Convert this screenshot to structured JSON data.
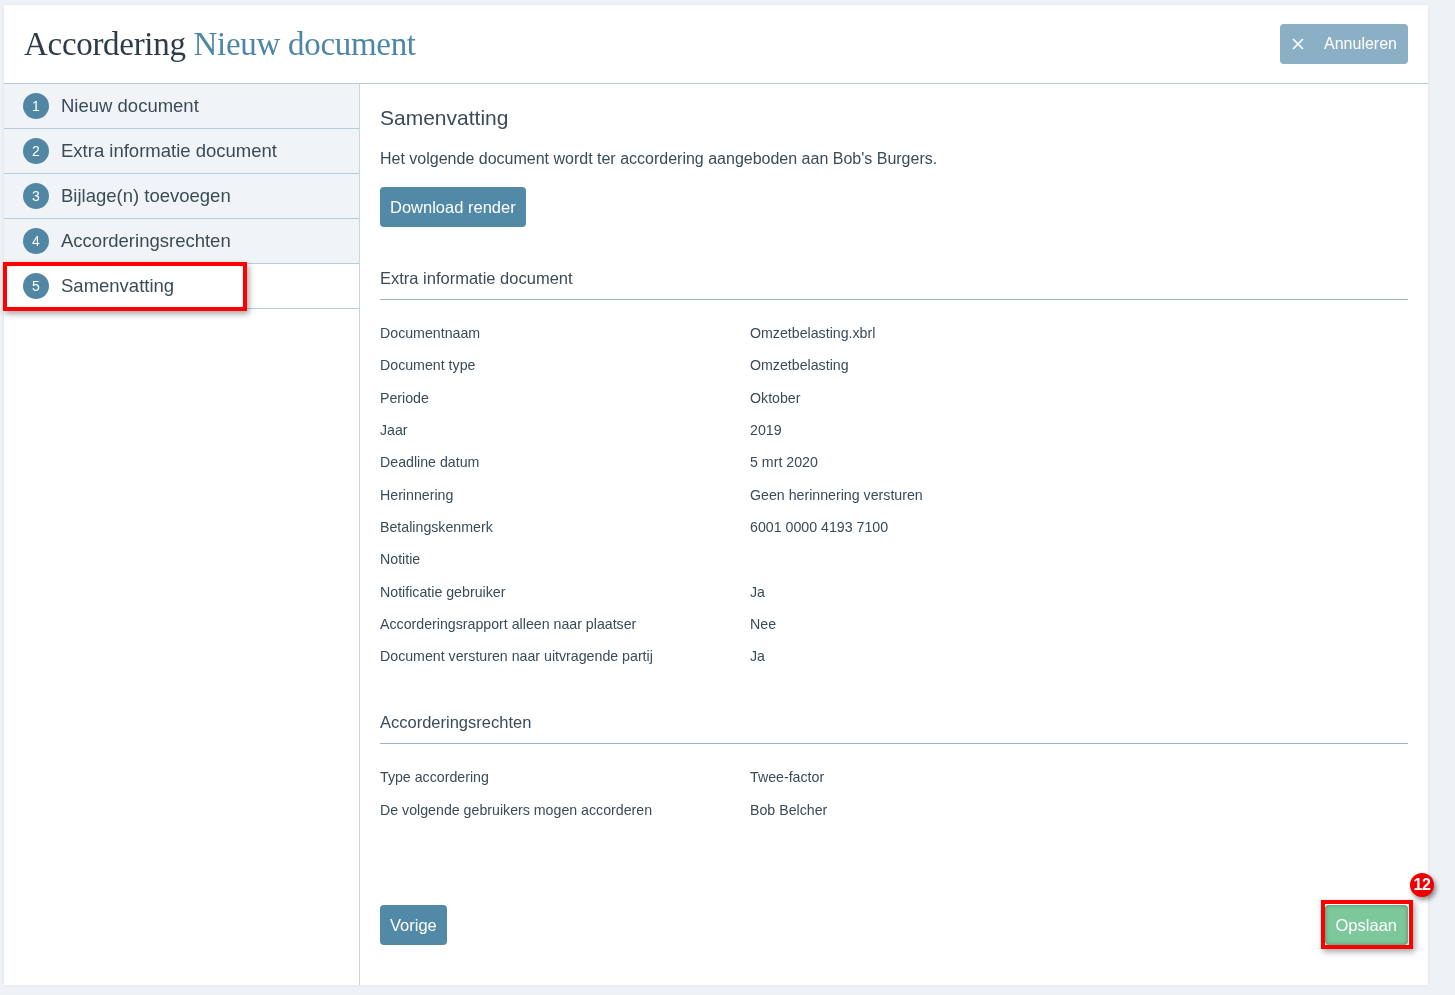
{
  "header": {
    "title": "Accordering",
    "subtitle": "Nieuw document",
    "cancel_button": "Annuleren"
  },
  "steps": [
    {
      "number": "1",
      "label": "Nieuw document",
      "selected": false,
      "highlighted": false
    },
    {
      "number": "2",
      "label": "Extra informatie document",
      "selected": false,
      "highlighted": false
    },
    {
      "number": "3",
      "label": "Bijlage(n) toevoegen",
      "selected": false,
      "highlighted": false
    },
    {
      "number": "4",
      "label": "Accorderingsrechten",
      "selected": false,
      "highlighted": false
    },
    {
      "number": "5",
      "label": "Samenvatting",
      "selected": true,
      "highlighted": true
    }
  ],
  "summary": {
    "title": "Samenvatting",
    "intro": "Het volgende document wordt ter accordering aangeboden aan Bob's Burgers.",
    "download_button": "Download render"
  },
  "sections": [
    {
      "title": "Extra informatie document",
      "rows": [
        {
          "label": "Documentnaam",
          "value": "Omzetbelasting.xbrl"
        },
        {
          "label": "Document type",
          "value": "Omzetbelasting"
        },
        {
          "label": "Periode",
          "value": "Oktober"
        },
        {
          "label": "Jaar",
          "value": "2019"
        },
        {
          "label": "Deadline datum",
          "value": "5 mrt 2020"
        },
        {
          "label": "Herinnering",
          "value": "Geen herinnering versturen"
        },
        {
          "label": "Betalingskenmerk",
          "value": "6001 0000 4193 7100"
        },
        {
          "label": "Notitie"
        },
        {
          "label": "Notificatie gebruiker",
          "value": "Ja"
        },
        {
          "label": "Accorderingsrapport alleen naar plaatser",
          "value": "Nee"
        },
        {
          "label": "Document versturen naar uitvragende partij",
          "value": "Ja"
        }
      ]
    },
    {
      "title": "Accorderingsrechten",
      "rows": [
        {
          "label": "Type accordering",
          "value": "Twee-factor"
        },
        {
          "label": "De volgende gebruikers mogen accorderen",
          "value": "Bob Belcher"
        }
      ]
    }
  ],
  "footer": {
    "back_button": "Vorige",
    "save_button": {
      "label": "Opslaan",
      "highlighted": true,
      "callout": "12"
    }
  }
}
